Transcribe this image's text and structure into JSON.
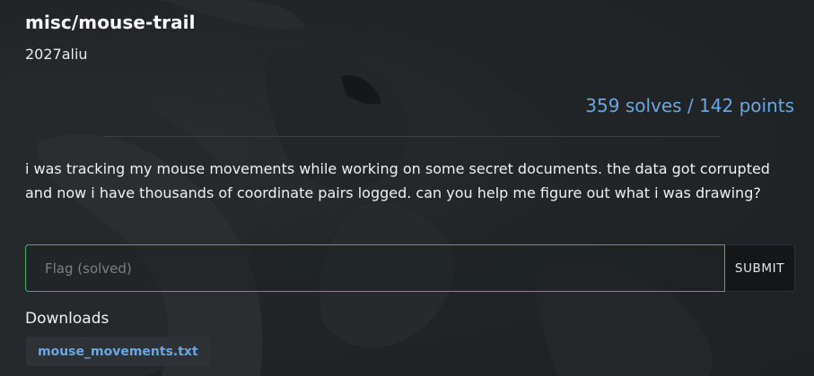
{
  "challenge": {
    "title": "misc/mouse-trail",
    "author": "2027aliu",
    "stats": "359 solves / 142 points",
    "description": "i was tracking my mouse movements while working on some secret documents. the data got corrupted and now i have thousands of coordinate pairs logged. can you help me figure out what i was drawing?"
  },
  "flag_form": {
    "placeholder": "Flag (solved)",
    "submit_label": "SUBMIT",
    "accent_color": "#3bb16a"
  },
  "downloads": {
    "label": "Downloads",
    "files": [
      {
        "name": "mouse_movements.txt"
      }
    ]
  },
  "colors": {
    "background": "#1f2224",
    "stats_text": "#6aa6e0",
    "link_text": "#6aa6e0"
  }
}
